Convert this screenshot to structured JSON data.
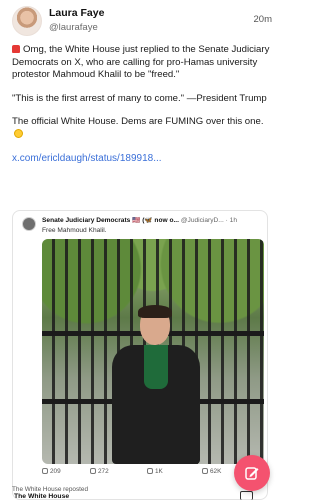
{
  "post": {
    "author_name": "Laura Faye",
    "author_handle": "@laurafaye",
    "time": "20m",
    "para1": "Omg, the White House just replied to the Senate Judiciary Democrats on X, who are calling for pro-Hamas university protestor Mahmoud Khalil to be \"freed.\"",
    "para2": "\"This is the first arrest of many to come.\" —President Trump",
    "para3": "The official White House. Dems are FUMING over this one.",
    "link": "x.com/ericldaugh/status/189918..."
  },
  "embed": {
    "name": "Senate Judiciary Democrats 🇺🇸 (🦋 now o...",
    "handle": "@JudiciaryD...",
    "time": "· 1h",
    "text": "Free Mahmoud Khalil.",
    "replies": "209",
    "reposts": "272",
    "likes": "1K",
    "views": "62K"
  },
  "footer": {
    "reposted_by": "The White House reposted",
    "next_author": "The White House"
  },
  "colors": {
    "link": "#3a6fd8",
    "fab": "#f4526f"
  },
  "icons": {
    "siren": "police-light-icon",
    "laugh": "laughing-emoji-icon",
    "compose": "compose-icon"
  }
}
